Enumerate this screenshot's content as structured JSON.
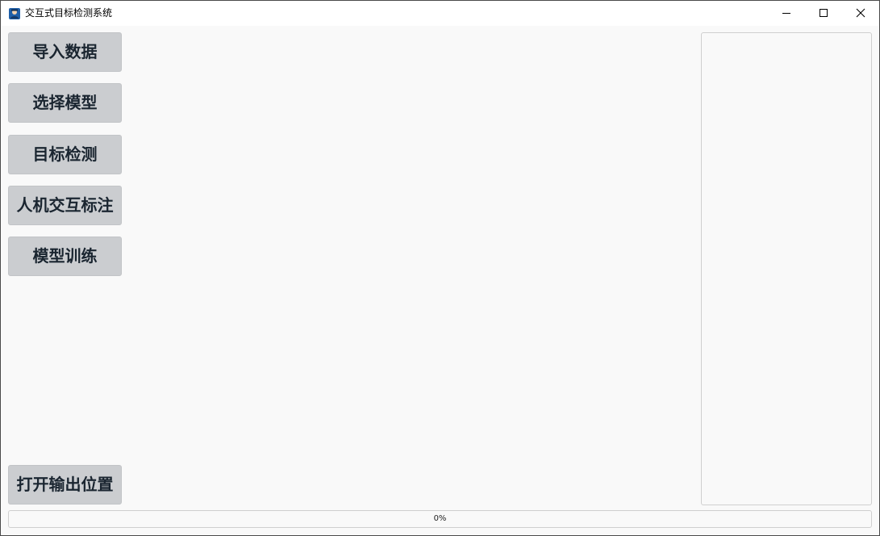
{
  "window": {
    "title": "交互式目标检测系统",
    "app_icon": "person-app-icon",
    "controls": {
      "minimize_icon": "minimize-icon",
      "maximize_icon": "maximize-icon",
      "close_icon": "close-icon"
    }
  },
  "sidebar": {
    "buttons": [
      {
        "label": "导入数据"
      },
      {
        "label": "选择模型"
      },
      {
        "label": "目标检测"
      },
      {
        "label": "人机交互标注"
      },
      {
        "label": "模型训练"
      }
    ],
    "bottom_button": {
      "label": "打开输出位置"
    }
  },
  "progress": {
    "value": 0,
    "text": "0%"
  },
  "colors": {
    "button_bg": "#cbcdd0",
    "button_text": "#1a2530",
    "window_bg": "#f9f9f9",
    "progress_fill": "#3c8dde"
  }
}
